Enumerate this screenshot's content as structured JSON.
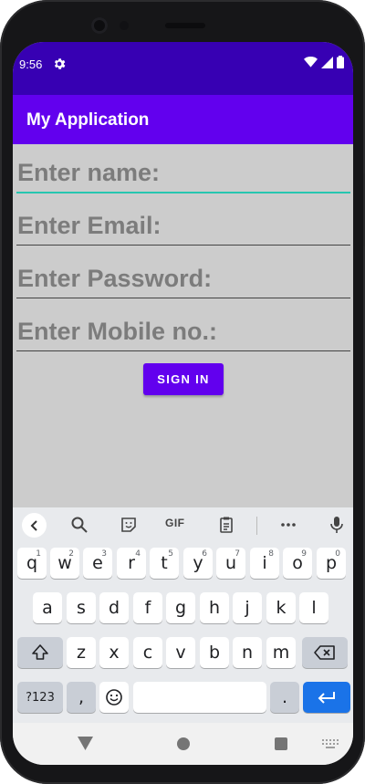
{
  "status_bar": {
    "time": "9:56",
    "settings_icon": "gear-icon",
    "wifi_icon": "wifi-icon",
    "signal_icon": "signal-icon",
    "battery_icon": "battery-icon"
  },
  "app_bar": {
    "title": "My Application"
  },
  "form": {
    "name_placeholder": "Enter name:",
    "email_placeholder": "Enter Email:",
    "password_placeholder": "Enter Password:",
    "mobile_placeholder": "Enter Mobile no.:",
    "sign_in_label": "SIGN IN"
  },
  "keyboard": {
    "toolbar": {
      "gif_label": "GIF"
    },
    "row1": [
      {
        "label": "q",
        "hint": "1"
      },
      {
        "label": "w",
        "hint": "2"
      },
      {
        "label": "e",
        "hint": "3"
      },
      {
        "label": "r",
        "hint": "4"
      },
      {
        "label": "t",
        "hint": "5"
      },
      {
        "label": "y",
        "hint": "6"
      },
      {
        "label": "u",
        "hint": "7"
      },
      {
        "label": "i",
        "hint": "8"
      },
      {
        "label": "o",
        "hint": "9"
      },
      {
        "label": "p",
        "hint": "0"
      }
    ],
    "row2": [
      "a",
      "s",
      "d",
      "f",
      "g",
      "h",
      "j",
      "k",
      "l"
    ],
    "row3": [
      "z",
      "x",
      "c",
      "v",
      "b",
      "n",
      "m"
    ],
    "symbols_label": "?123",
    "comma_label": ",",
    "period_label": "."
  },
  "colors": {
    "status_bar": "#3700b3",
    "primary": "#6200ee",
    "background": "#cccccc",
    "focus_underline": "#26c6b0",
    "enter_key": "#1a73e8"
  }
}
